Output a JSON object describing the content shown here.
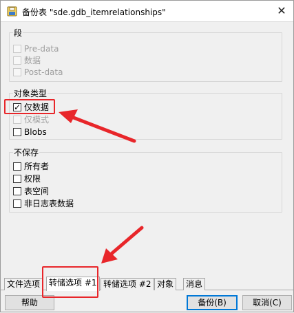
{
  "window": {
    "title": "备份表 \"sde.gdb_itemrelationships\"",
    "close_glyph": "✕"
  },
  "groups": {
    "segment": {
      "label": "段",
      "items": [
        {
          "label": "Pre-data",
          "checked": false,
          "disabled": true
        },
        {
          "label": "数据",
          "checked": false,
          "disabled": true
        },
        {
          "label": "Post-data",
          "checked": false,
          "disabled": true
        }
      ]
    },
    "object_type": {
      "label": "对象类型",
      "items": [
        {
          "label": "仅数据",
          "checked": true,
          "disabled": false
        },
        {
          "label": "仅模式",
          "checked": false,
          "disabled": true
        },
        {
          "label": "Blobs",
          "checked": false,
          "disabled": false
        }
      ]
    },
    "do_not_save": {
      "label": "不保存",
      "items": [
        {
          "label": "所有者",
          "checked": false,
          "disabled": false
        },
        {
          "label": "权限",
          "checked": false,
          "disabled": false
        },
        {
          "label": "表空间",
          "checked": false,
          "disabled": false
        },
        {
          "label": "非日志表数据",
          "checked": false,
          "disabled": false
        }
      ]
    }
  },
  "tabs": [
    {
      "label": "文件选项",
      "active": false
    },
    {
      "label": "转储选项 #1",
      "active": true
    },
    {
      "label": "转储选项 #2",
      "active": false
    },
    {
      "label": "对象",
      "active": false
    },
    {
      "label": "消息",
      "active": false
    }
  ],
  "buttons": {
    "help": "帮助",
    "backup": "备份(B)",
    "cancel": "取消(C)"
  },
  "annotation_color": "#e8262a",
  "icons": {
    "app": "database-save-icon",
    "check": "checkmark-icon"
  }
}
